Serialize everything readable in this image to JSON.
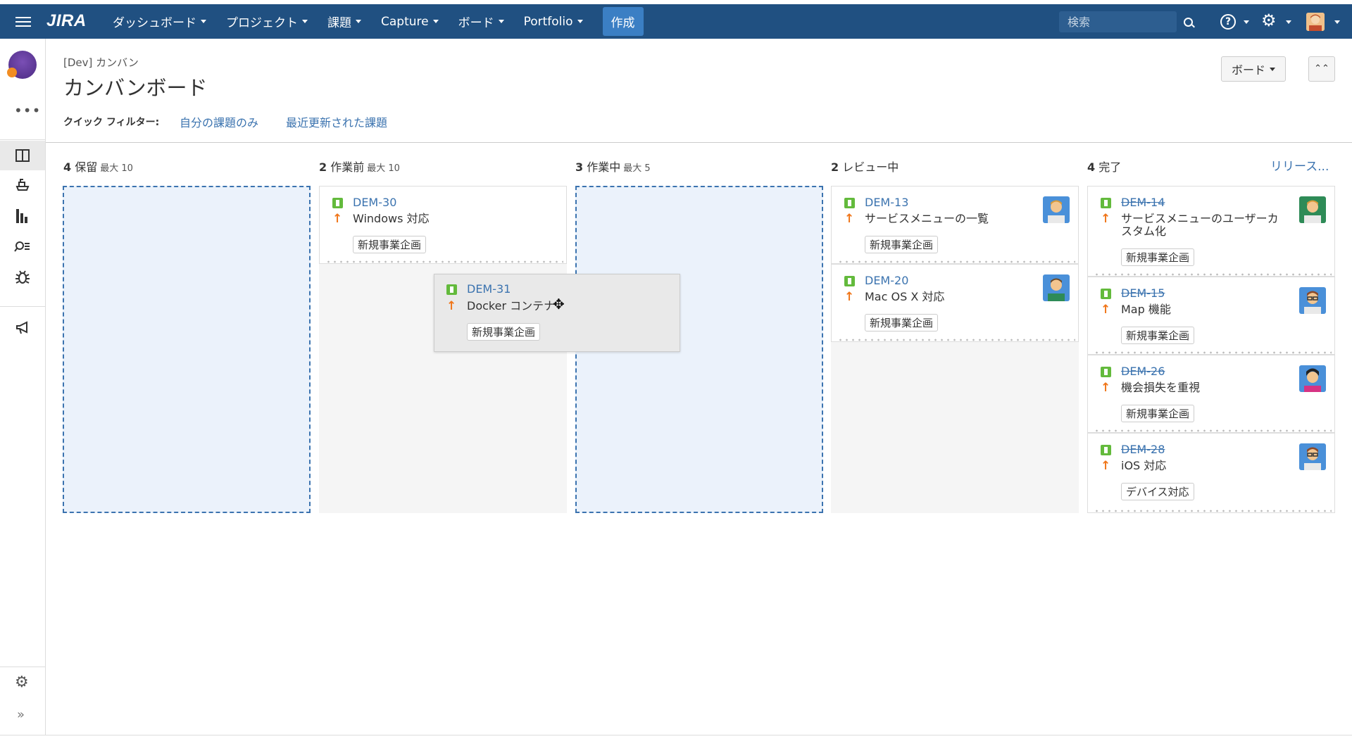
{
  "nav": {
    "logo": "JIRA",
    "items": [
      "ダッシュボード",
      "プロジェクト",
      "課題",
      "Capture",
      "ボード",
      "Portfolio"
    ],
    "create": "作成",
    "search_placeholder": "検索",
    "help": "?"
  },
  "header": {
    "breadcrumb": "[Dev] カンバン",
    "title": "カンバンボード",
    "board_button": "ボード",
    "quick_filter_label": "クイック フィルター:",
    "quick_filters": [
      "自分の課題のみ",
      "最近更新された課題"
    ]
  },
  "columns": [
    {
      "count": "4",
      "name": "保留",
      "limit": "最大 10"
    },
    {
      "count": "2",
      "name": "作業前",
      "limit": "最大 10"
    },
    {
      "count": "3",
      "name": "作業中",
      "limit": "最大 5"
    },
    {
      "count": "2",
      "name": "レビュー中",
      "limit": ""
    },
    {
      "count": "4",
      "name": "完了",
      "limit": ""
    }
  ],
  "release_link": "リリース...",
  "cards": {
    "dem30": {
      "key": "DEM-30",
      "summary": "Windows 対応",
      "label": "新規事業企画"
    },
    "dem31": {
      "key": "DEM-31",
      "summary": "Docker コンテナ",
      "label": "新規事業企画"
    },
    "dem13": {
      "key": "DEM-13",
      "summary": "サービスメニューの一覧",
      "label": "新規事業企画"
    },
    "dem20": {
      "key": "DEM-20",
      "summary": "Mac OS X 対応",
      "label": "新規事業企画"
    },
    "dem14": {
      "key": "DEM-14",
      "summary_line1": "サービスメニューのユーザーカ",
      "summary_line2": "スタム化",
      "label": "新規事業企画"
    },
    "dem15": {
      "key": "DEM-15",
      "summary": "Map 機能",
      "label": "新規事業企画"
    },
    "dem26": {
      "key": "DEM-26",
      "summary": "機会損失を重視",
      "label": "新規事業企画"
    },
    "dem28": {
      "key": "DEM-28",
      "summary": "iOS 対応",
      "label": "デバイス対応"
    }
  },
  "colors": {
    "nav": "#205081",
    "link": "#3b73af",
    "story": "#63ba3c",
    "priority": "#f0761a"
  }
}
